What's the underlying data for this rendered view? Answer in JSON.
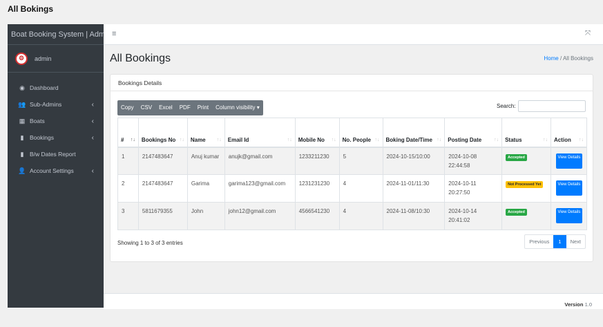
{
  "page": {
    "heading": "All Bokings"
  },
  "sidebar": {
    "brand": "Boat Booking System | Admin",
    "user": "admin",
    "avatar_text": "⚙",
    "items": [
      {
        "label": "Dashboard",
        "icon": "dashboard-icon",
        "glyph": "◉",
        "caret": ""
      },
      {
        "label": "Sub-Admins",
        "icon": "users-icon",
        "glyph": "👥",
        "caret": "‹"
      },
      {
        "label": "Boats",
        "icon": "table-icon",
        "glyph": "▦",
        "caret": "‹"
      },
      {
        "label": "Bookings",
        "icon": "file-icon",
        "glyph": "▮",
        "caret": "‹"
      },
      {
        "label": "B/w Dates Report",
        "icon": "file-icon",
        "glyph": "▮",
        "caret": ""
      },
      {
        "label": "Account Settings",
        "icon": "user-cog-icon",
        "glyph": "👤",
        "caret": "‹"
      }
    ]
  },
  "topbar": {
    "menu_glyph": "≡",
    "expand_glyph": "⤧"
  },
  "content": {
    "title": "All Bookings",
    "breadcrumb_home": "Home",
    "breadcrumb_sep": " / ",
    "breadcrumb_current": "All Bookings"
  },
  "card": {
    "header": "Bookings Details",
    "buttons": [
      "Copy",
      "CSV",
      "Excel",
      "PDF",
      "Print",
      "Column visibility ▾"
    ],
    "search_label": "Search:",
    "info": "Showing 1 to 3 of 3 entries",
    "pagination": {
      "prev": "Previous",
      "current": "1",
      "next": "Next"
    }
  },
  "table": {
    "columns": [
      "#",
      "Bookings No",
      "Name",
      "Email Id",
      "Mobile No",
      "No. People",
      "Boking Date/Time",
      "Posting Date",
      "Status",
      "Action"
    ],
    "rows": [
      {
        "idx": "1",
        "booking_no": "2147483647",
        "name": "Anuj kumar",
        "email": "anujk@gmail.com",
        "mobile": "1233211230",
        "people": "5",
        "booking_dt": "2024-10-15/10:00",
        "posting_date": "2024-10-08 22:44:58",
        "status": "Accepted",
        "status_color": "#28a745",
        "action": "View Details"
      },
      {
        "idx": "2",
        "booking_no": "2147483647",
        "name": "Garima",
        "email": "garima123@gmail.com",
        "mobile": "1231231230",
        "people": "4",
        "booking_dt": "2024-11-01/11:30",
        "posting_date": "2024-10-11 20:27:50",
        "status": "Not Processed Yet",
        "status_color": "#ffc107",
        "action": "View Details"
      },
      {
        "idx": "3",
        "booking_no": "5811679355",
        "name": "John",
        "email": "john12@gmail.com",
        "mobile": "4566541230",
        "people": "4",
        "booking_dt": "2024-11-08/10:30",
        "posting_date": "2024-10-14 20:41:02",
        "status": "Accepted",
        "status_color": "#28a745",
        "action": "View Details"
      }
    ]
  },
  "footer": {
    "version_label": "Version",
    "version_number": "1.0"
  }
}
